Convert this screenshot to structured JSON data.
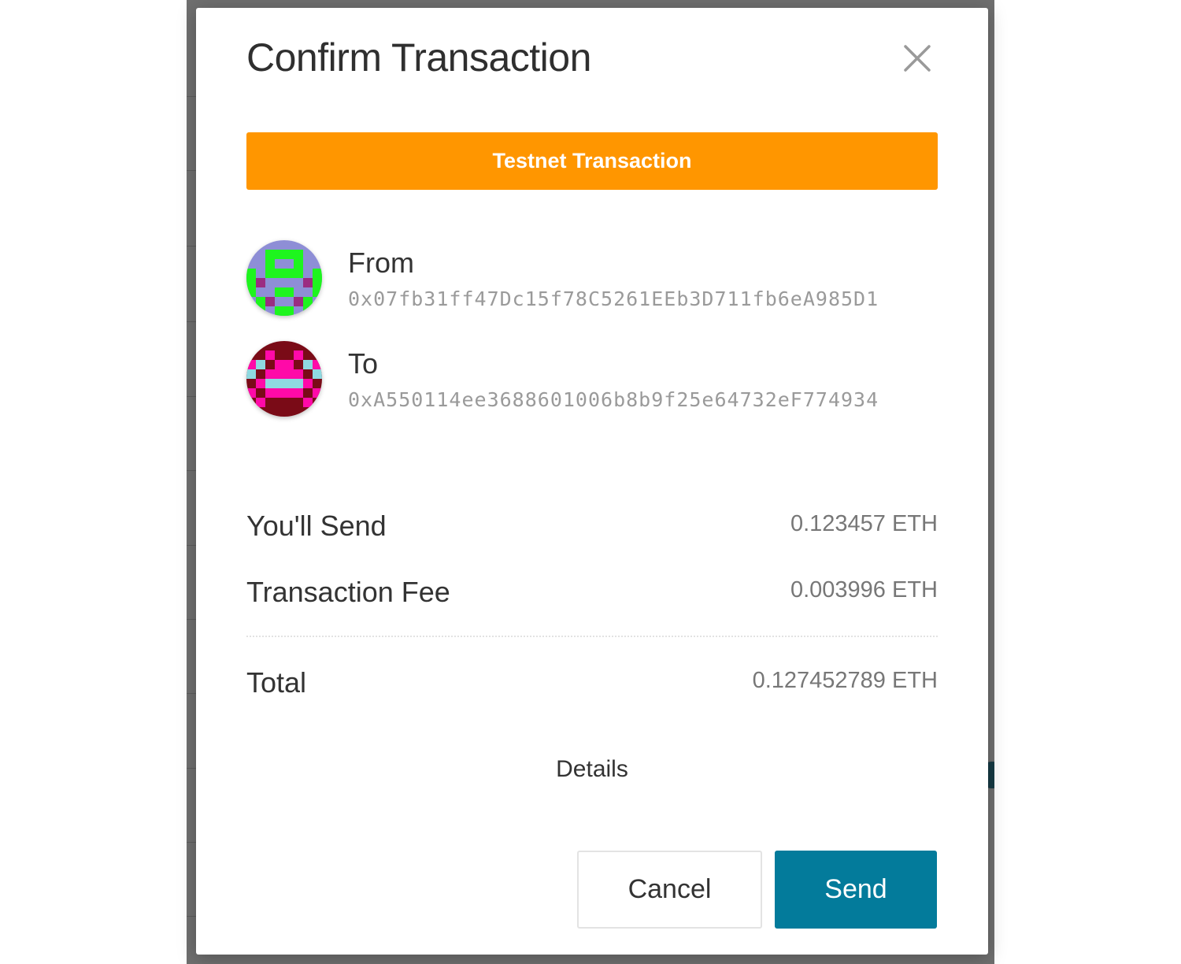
{
  "modal": {
    "title": "Confirm Transaction",
    "banner": "Testnet Transaction"
  },
  "from": {
    "label": "From",
    "address": "0x07fb31ff47Dc15f78C5261EEb3D711fb6eA985D1",
    "avatar_icon": "identicon-green-purple"
  },
  "to": {
    "label": "To",
    "address": "0xA550114ee3688601006b8b9f25e64732eF774934",
    "avatar_icon": "identicon-magenta-maroon"
  },
  "summary": {
    "send_label": "You'll Send",
    "send_value": "0.123457 ETH",
    "fee_label": "Transaction Fee",
    "fee_value": "0.003996 ETH",
    "total_label": "Total",
    "total_value": "0.127452789 ETH"
  },
  "details_label": "Details",
  "buttons": {
    "cancel": "Cancel",
    "send": "Send"
  },
  "colors": {
    "banner": "#ff9600",
    "send_button": "#037b9b"
  }
}
